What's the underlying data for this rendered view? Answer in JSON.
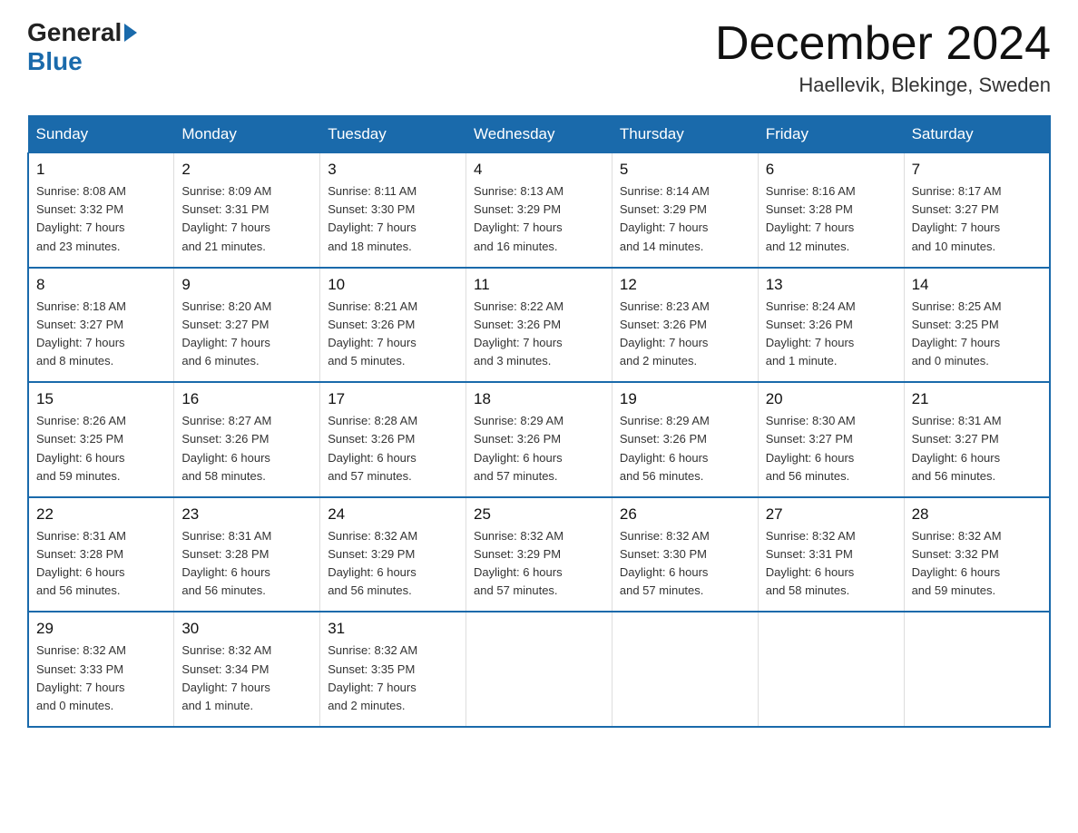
{
  "logo": {
    "general": "General",
    "blue": "Blue"
  },
  "header": {
    "month": "December 2024",
    "location": "Haellevik, Blekinge, Sweden"
  },
  "days_of_week": [
    "Sunday",
    "Monday",
    "Tuesday",
    "Wednesday",
    "Thursday",
    "Friday",
    "Saturday"
  ],
  "weeks": [
    [
      {
        "day": "1",
        "sunrise": "8:08 AM",
        "sunset": "3:32 PM",
        "daylight": "7 hours and 23 minutes."
      },
      {
        "day": "2",
        "sunrise": "8:09 AM",
        "sunset": "3:31 PM",
        "daylight": "7 hours and 21 minutes."
      },
      {
        "day": "3",
        "sunrise": "8:11 AM",
        "sunset": "3:30 PM",
        "daylight": "7 hours and 18 minutes."
      },
      {
        "day": "4",
        "sunrise": "8:13 AM",
        "sunset": "3:29 PM",
        "daylight": "7 hours and 16 minutes."
      },
      {
        "day": "5",
        "sunrise": "8:14 AM",
        "sunset": "3:29 PM",
        "daylight": "7 hours and 14 minutes."
      },
      {
        "day": "6",
        "sunrise": "8:16 AM",
        "sunset": "3:28 PM",
        "daylight": "7 hours and 12 minutes."
      },
      {
        "day": "7",
        "sunrise": "8:17 AM",
        "sunset": "3:27 PM",
        "daylight": "7 hours and 10 minutes."
      }
    ],
    [
      {
        "day": "8",
        "sunrise": "8:18 AM",
        "sunset": "3:27 PM",
        "daylight": "7 hours and 8 minutes."
      },
      {
        "day": "9",
        "sunrise": "8:20 AM",
        "sunset": "3:27 PM",
        "daylight": "7 hours and 6 minutes."
      },
      {
        "day": "10",
        "sunrise": "8:21 AM",
        "sunset": "3:26 PM",
        "daylight": "7 hours and 5 minutes."
      },
      {
        "day": "11",
        "sunrise": "8:22 AM",
        "sunset": "3:26 PM",
        "daylight": "7 hours and 3 minutes."
      },
      {
        "day": "12",
        "sunrise": "8:23 AM",
        "sunset": "3:26 PM",
        "daylight": "7 hours and 2 minutes."
      },
      {
        "day": "13",
        "sunrise": "8:24 AM",
        "sunset": "3:26 PM",
        "daylight": "7 hours and 1 minute."
      },
      {
        "day": "14",
        "sunrise": "8:25 AM",
        "sunset": "3:25 PM",
        "daylight": "7 hours and 0 minutes."
      }
    ],
    [
      {
        "day": "15",
        "sunrise": "8:26 AM",
        "sunset": "3:25 PM",
        "daylight": "6 hours and 59 minutes."
      },
      {
        "day": "16",
        "sunrise": "8:27 AM",
        "sunset": "3:26 PM",
        "daylight": "6 hours and 58 minutes."
      },
      {
        "day": "17",
        "sunrise": "8:28 AM",
        "sunset": "3:26 PM",
        "daylight": "6 hours and 57 minutes."
      },
      {
        "day": "18",
        "sunrise": "8:29 AM",
        "sunset": "3:26 PM",
        "daylight": "6 hours and 57 minutes."
      },
      {
        "day": "19",
        "sunrise": "8:29 AM",
        "sunset": "3:26 PM",
        "daylight": "6 hours and 56 minutes."
      },
      {
        "day": "20",
        "sunrise": "8:30 AM",
        "sunset": "3:27 PM",
        "daylight": "6 hours and 56 minutes."
      },
      {
        "day": "21",
        "sunrise": "8:31 AM",
        "sunset": "3:27 PM",
        "daylight": "6 hours and 56 minutes."
      }
    ],
    [
      {
        "day": "22",
        "sunrise": "8:31 AM",
        "sunset": "3:28 PM",
        "daylight": "6 hours and 56 minutes."
      },
      {
        "day": "23",
        "sunrise": "8:31 AM",
        "sunset": "3:28 PM",
        "daylight": "6 hours and 56 minutes."
      },
      {
        "day": "24",
        "sunrise": "8:32 AM",
        "sunset": "3:29 PM",
        "daylight": "6 hours and 56 minutes."
      },
      {
        "day": "25",
        "sunrise": "8:32 AM",
        "sunset": "3:29 PM",
        "daylight": "6 hours and 57 minutes."
      },
      {
        "day": "26",
        "sunrise": "8:32 AM",
        "sunset": "3:30 PM",
        "daylight": "6 hours and 57 minutes."
      },
      {
        "day": "27",
        "sunrise": "8:32 AM",
        "sunset": "3:31 PM",
        "daylight": "6 hours and 58 minutes."
      },
      {
        "day": "28",
        "sunrise": "8:32 AM",
        "sunset": "3:32 PM",
        "daylight": "6 hours and 59 minutes."
      }
    ],
    [
      {
        "day": "29",
        "sunrise": "8:32 AM",
        "sunset": "3:33 PM",
        "daylight": "7 hours and 0 minutes."
      },
      {
        "day": "30",
        "sunrise": "8:32 AM",
        "sunset": "3:34 PM",
        "daylight": "7 hours and 1 minute."
      },
      {
        "day": "31",
        "sunrise": "8:32 AM",
        "sunset": "3:35 PM",
        "daylight": "7 hours and 2 minutes."
      },
      null,
      null,
      null,
      null
    ]
  ]
}
